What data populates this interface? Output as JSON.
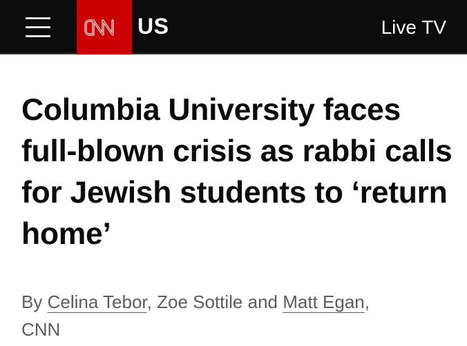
{
  "header": {
    "menu_icon": "hamburger-menu-icon",
    "logo_text": "CNN",
    "logo_color": "#cc0000",
    "section": "US",
    "live_tv": "Live TV"
  },
  "article": {
    "headline": "Columbia University faces full-blown crisis as rabbi calls for Jewish students to ‘return home’",
    "byline": {
      "prefix": "By ",
      "author1": "Celina Tebor",
      "sep1": ", ",
      "author2": "Zoe Sottile",
      "sep2": " and ",
      "author3": "Matt Egan",
      "sep3": ",",
      "outlet": "CNN"
    }
  }
}
